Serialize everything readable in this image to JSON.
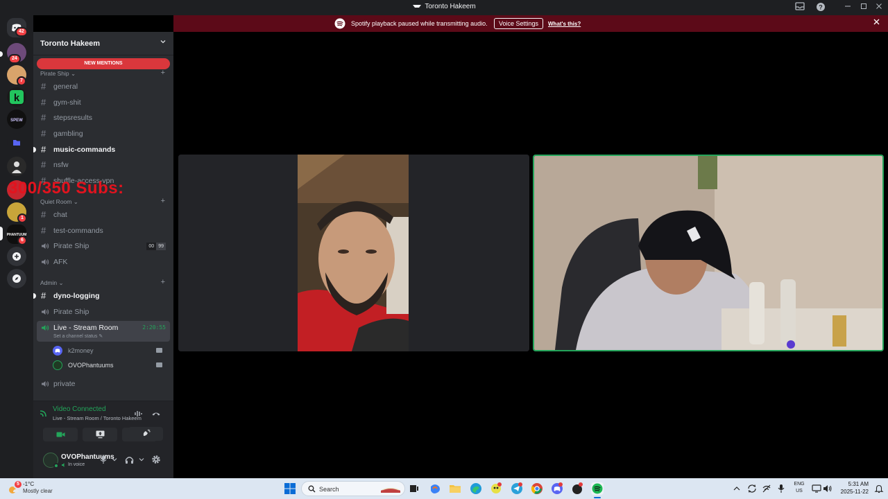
{
  "window": {
    "title": "Toronto Hakeem"
  },
  "rail": {
    "dm_badge": "42",
    "servers": [
      {
        "name": "server-1",
        "color": "#6d4a7a",
        "badge": "24"
      },
      {
        "name": "server-2",
        "color": "#d9a46b",
        "badge": "7"
      },
      {
        "name": "server-3",
        "color": "#1a1a1a",
        "badge": ""
      },
      {
        "name": "server-4",
        "color": "#101010",
        "badge": ""
      },
      {
        "name": "server-5",
        "color": "#3d4a9a",
        "badge": ""
      },
      {
        "name": "server-6",
        "color": "#2a2a2a",
        "badge": ""
      },
      {
        "name": "server-7",
        "color": "#c7262f",
        "badge": ""
      },
      {
        "name": "server-8",
        "color": "#c8a53a",
        "badge": "1"
      },
      {
        "name": "server-9",
        "color": "#0f0f0f",
        "badge": "6"
      }
    ]
  },
  "sidebar": {
    "guild_name": "Toronto Hakeem",
    "new_mentions": "NEW MENTIONS",
    "categories": {
      "pirate_ship": "Pirate Ship",
      "quiet_room": "Quiet Room",
      "admin": "Admin"
    },
    "channels": {
      "general": "general",
      "gym_shit": "gym-shit",
      "stepsresults": "stepsresults",
      "gambling": "gambling",
      "music_commands": "music-commands",
      "nsfw": "nsfw",
      "shuffle_access_vpn": "shuffle-access-vpn",
      "chat": "chat",
      "test_commands": "test-commands",
      "pirate_ship_voice": "Pirate Ship",
      "pirate_ship_count_a": "00",
      "pirate_ship_count_b": "99",
      "afk": "AFK",
      "dyno_logging": "dyno-logging",
      "pirate_ship_voice_2": "Pirate Ship",
      "live_stream_room": "Live - Stream Room",
      "live_timer": "2:20:55",
      "live_status": "Set a channel status",
      "private": "private"
    },
    "voice_users": [
      {
        "name": "k2money"
      },
      {
        "name": "OVOPhantuums"
      }
    ]
  },
  "overlay": {
    "text": "300/350  Subs:"
  },
  "voice_panel": {
    "status": "Video Connected",
    "room": "Live - Stream Room / Toronto Hakeem"
  },
  "user_panel": {
    "username": "OVOPhantuums",
    "status": "In voice"
  },
  "banner": {
    "message": "Spotify playback paused while transmitting audio.",
    "button": "Voice Settings",
    "link": "What's this?"
  },
  "taskbar": {
    "weather_badge": "5",
    "temp": "-1°C",
    "weather": "Mostly clear",
    "search_placeholder": "Search",
    "lang_1": "ENG",
    "lang_2": "US",
    "time": "5:31 AM",
    "date": "2025-11-22"
  }
}
